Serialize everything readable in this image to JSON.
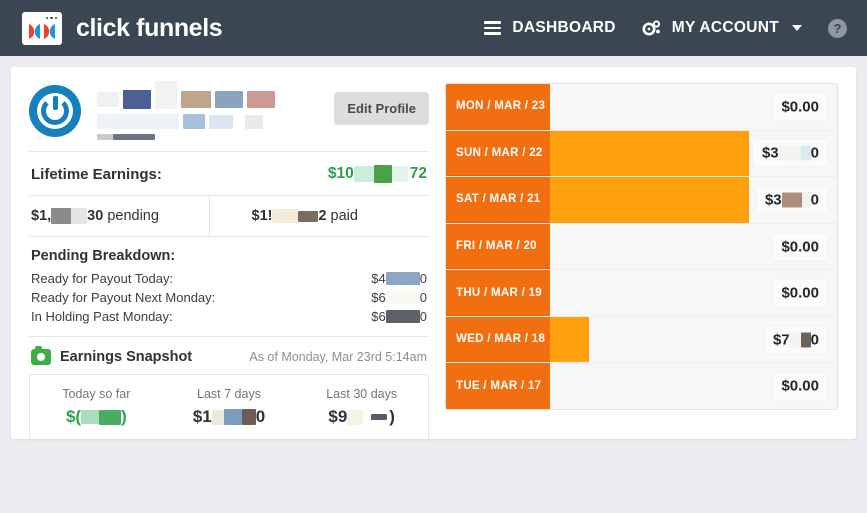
{
  "header": {
    "brand_name": "click funnels",
    "logo_icon": "clickfunnels-window-icon",
    "menu_icon": "hamburger-icon",
    "dashboard_label": "DASHBOARD",
    "account_icon": "gears-icon",
    "account_label": "MY ACCOUNT",
    "caret_icon": "chevron-down-icon",
    "help_icon": "question-mark-icon",
    "help_label": "?",
    "background_color": "#3b4653"
  },
  "profile": {
    "avatar_icon": "power-button-avatar-icon",
    "name_redacted": true,
    "edit_button_label": "Edit Profile"
  },
  "earnings": {
    "lifetime_label": "Lifetime Earnings:",
    "lifetime_value_prefix": "$10",
    "lifetime_value_suffix": "72",
    "lifetime_value_color": "#2aa34a",
    "pending_prefix": "$1,",
    "pending_suffix": "30",
    "pending_label": "pending",
    "paid_prefix": "$1!",
    "paid_suffix": "2",
    "paid_label": "paid"
  },
  "breakdown": {
    "title": "Pending Breakdown:",
    "rows": [
      {
        "label": "Ready for Payout Today:",
        "value_prefix": "$4",
        "value_suffix": "0"
      },
      {
        "label": "Ready for Payout Next Monday:",
        "value_prefix": "$6",
        "value_suffix": "0"
      },
      {
        "label": "In Holding Past Monday:",
        "value_prefix": "$6",
        "value_suffix": "0"
      }
    ]
  },
  "snapshot": {
    "icon": "camera-icon",
    "title": "Earnings Snapshot",
    "as_of": "As of Monday, Mar 23rd 5:14am",
    "cells": [
      {
        "label": "Today so far",
        "value_prefix": "$(",
        "value_suffix": ")",
        "color": "#2aa34a"
      },
      {
        "label": "Last 7 days",
        "value_prefix": "$1",
        "value_suffix": "0",
        "color": "#2f3337"
      },
      {
        "label": "Last 30 days",
        "value_prefix": "$9",
        "value_suffix": ")",
        "color": "#2f3337"
      }
    ]
  },
  "chart_data": {
    "type": "bar",
    "orientation": "horizontal",
    "title": "Daily Earnings",
    "categories": [
      "MON / MAR / 23",
      "SUN / MAR / 22",
      "SAT / MAR / 21",
      "FRI / MAR / 20",
      "THU / MAR / 19",
      "WED / MAR / 18",
      "TUE / MAR / 17"
    ],
    "value_labels": [
      "$0.00",
      "$3   0",
      "$3   0",
      "$0.00",
      "$0.00",
      "$7  0",
      "$0.00"
    ],
    "values": [
      0,
      355,
      355,
      0,
      0,
      75,
      0
    ],
    "bar_fractions": [
      0,
      1.0,
      1.0,
      0,
      0,
      0.19,
      0
    ],
    "redacted": [
      false,
      true,
      true,
      false,
      false,
      true,
      false
    ],
    "xlabel": "",
    "ylabel": "",
    "grid": false,
    "legend": "none",
    "bar_color": "#ffa00c",
    "label_color": "#f26f11"
  }
}
